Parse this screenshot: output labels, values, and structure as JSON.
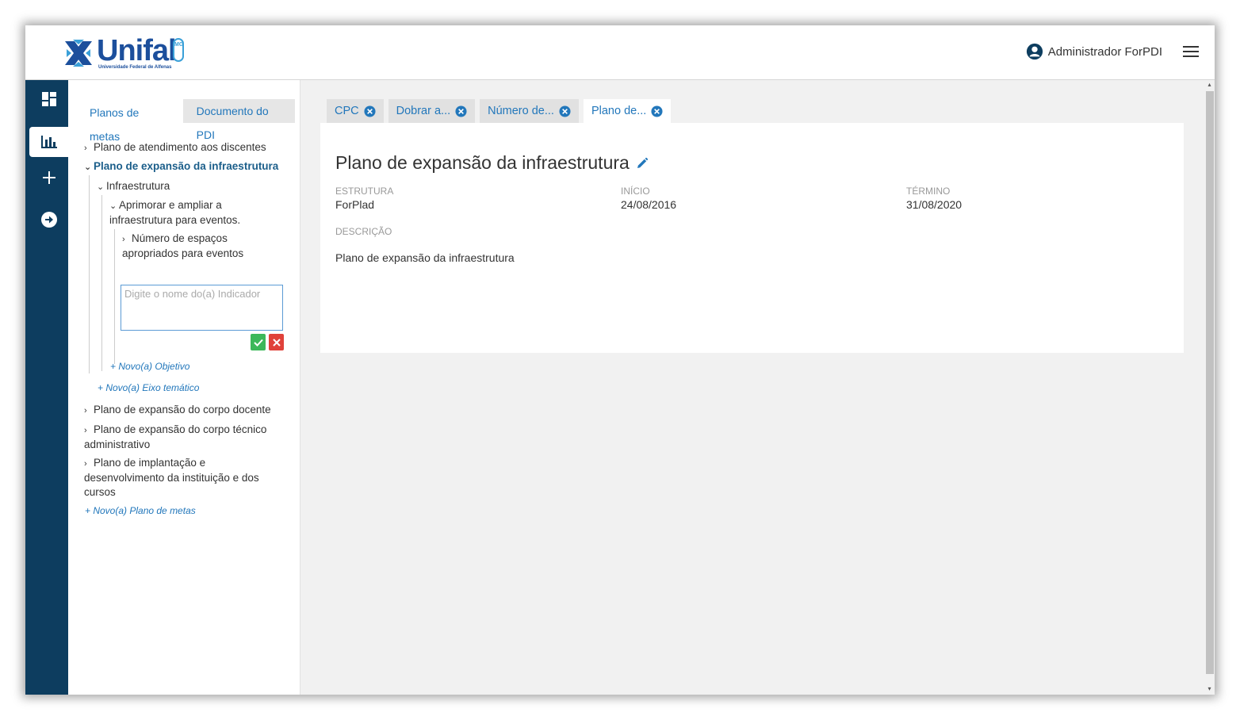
{
  "header": {
    "logo_text": "Unifal",
    "logo_subtitle": "Universidade Federal de Alfenas",
    "logo_badge": "MG",
    "user_name": "Administrador ForPDI"
  },
  "rail": {
    "items": [
      {
        "icon": "dashboard-icon"
      },
      {
        "icon": "bar-chart-icon",
        "active": true
      },
      {
        "icon": "plus-icon"
      },
      {
        "icon": "arrow-right-circle-icon"
      }
    ]
  },
  "panel": {
    "tabs": [
      "Planos de metas",
      "Documento do PDI"
    ],
    "tree": {
      "plan1": "Plano de atendimento aos discentes",
      "plan2": "Plano de expansão da infraestrutura",
      "axis": "Infraestrutura",
      "objective_line1": "Aprimorar e ampliar a",
      "objective_line2": "infraestrutura para eventos.",
      "indicator_line1": "Número de espaços",
      "indicator_line2": "apropriados para eventos",
      "indicator_placeholder": "Digite o nome do(a) Indicador",
      "add_objective": "+ Novo(a) Objetivo",
      "add_axis": "+ Novo(a) Eixo temático",
      "plan3": "Plano de expansão do corpo docente",
      "plan4_line1": "Plano de expansão do corpo técnico",
      "plan4_line2": "administrativo",
      "plan5_line1": "Plano de implantação e",
      "plan5_line2": "desenvolvimento da instituição e dos",
      "plan5_line3": "cursos",
      "add_plan": "+ Novo(a) Plano de metas"
    }
  },
  "tabs": [
    {
      "label": "CPC"
    },
    {
      "label": "Dobrar a..."
    },
    {
      "label": "Número de..."
    },
    {
      "label": "Plano de...",
      "active": true
    }
  ],
  "card": {
    "title": "Plano de expansão da infraestrutura",
    "structure_label": "ESTRUTURA",
    "structure_value": "ForPlad",
    "start_label": "INÍCIO",
    "start_value": "24/08/2016",
    "end_label": "TÉRMINO",
    "end_value": "31/08/2020",
    "desc_label": "DESCRIÇÃO",
    "desc_value": "Plano de expansão da infraestrutura"
  },
  "colors": {
    "rail": "#0d3d5f",
    "accent": "#2277bb",
    "ok": "#3cb85a",
    "cancel": "#e0423a"
  }
}
